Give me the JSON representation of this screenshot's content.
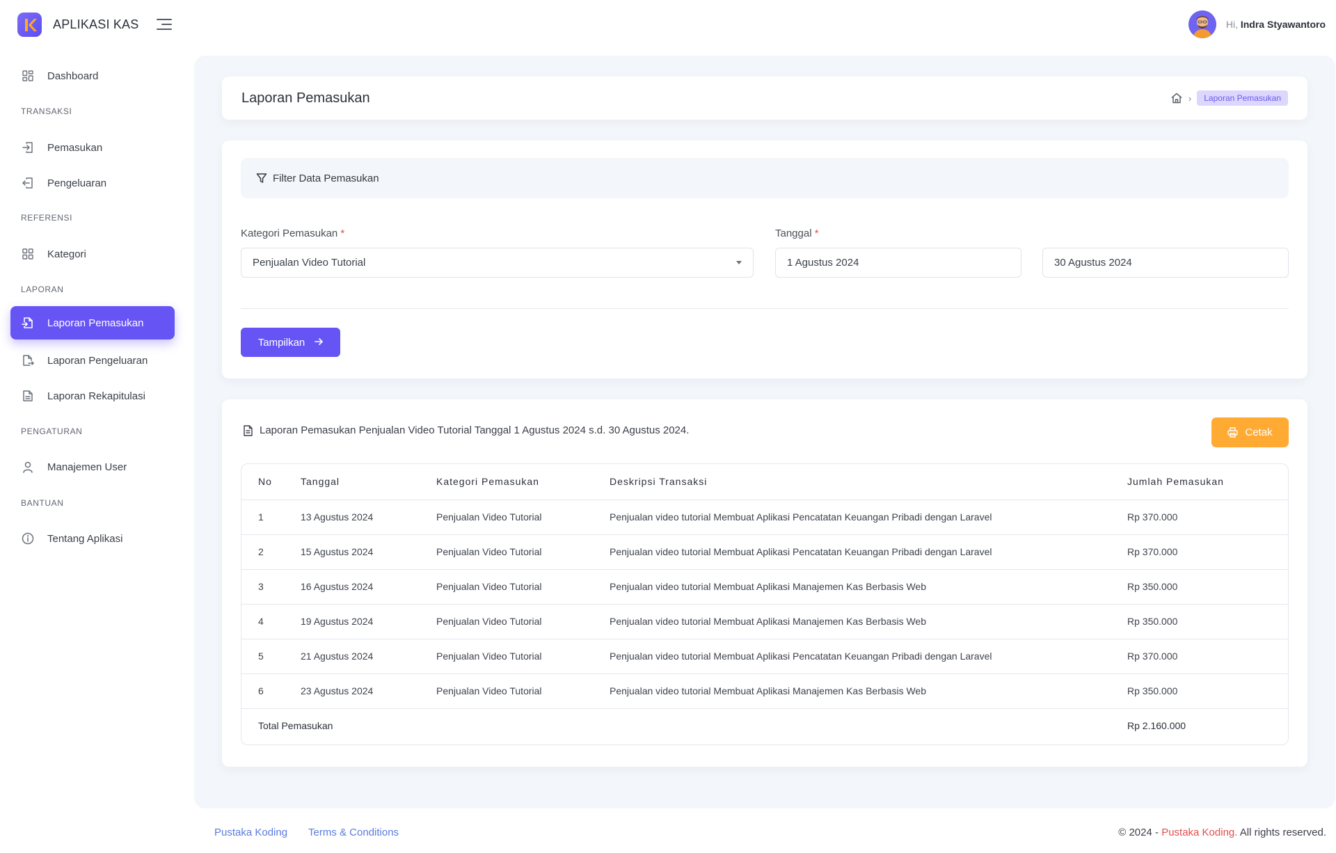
{
  "app": {
    "name": "APLIKASI KAS",
    "accent_color": "#6754f5"
  },
  "user": {
    "greeting": "Hi,",
    "name": "Indra Styawantoro"
  },
  "sidebar": {
    "items": [
      {
        "label": "Dashboard",
        "icon": "grid-icon"
      },
      {
        "label": "TRANSAKSI"
      },
      {
        "label": "Pemasukan",
        "icon": "login-icon"
      },
      {
        "label": "Pengeluaran",
        "icon": "logout-icon"
      },
      {
        "label": "REFERENSI"
      },
      {
        "label": "Kategori",
        "icon": "grid-icon"
      },
      {
        "label": "LAPORAN"
      },
      {
        "label": "Laporan Pemasukan",
        "icon": "file-import-icon",
        "active": true
      },
      {
        "label": "Laporan Pengeluaran",
        "icon": "file-export-icon"
      },
      {
        "label": "Laporan Rekapitulasi",
        "icon": "file-text-icon"
      },
      {
        "label": "PENGATURAN"
      },
      {
        "label": "Manajemen User",
        "icon": "user-icon"
      },
      {
        "label": "BANTUAN"
      },
      {
        "label": "Tentang Aplikasi",
        "icon": "info-icon"
      }
    ]
  },
  "page": {
    "title": "Laporan Pemasukan",
    "breadcrumb_current": "Laporan Pemasukan"
  },
  "filter": {
    "heading": "Filter Data Pemasukan",
    "kategori_label": "Kategori Pemasukan",
    "kategori_value": "Penjualan Video Tutorial",
    "tanggal_label": "Tanggal",
    "required_mark": "*",
    "tanggal_awal": "1 Agustus 2024",
    "tanggal_akhir": "30 Agustus 2024",
    "submit_label": "Tampilkan"
  },
  "result": {
    "caption": "Laporan Pemasukan Penjualan Video Tutorial Tanggal 1 Agustus 2024 s.d. 30 Agustus 2024.",
    "print_label": "Cetak",
    "print_color": "#ffab33",
    "columns": [
      "No",
      "Tanggal",
      "Kategori Pemasukan",
      "Deskripsi Transaksi",
      "Jumlah Pemasukan"
    ],
    "rows": [
      [
        "1",
        "13 Agustus 2024",
        "Penjualan Video Tutorial",
        "Penjualan video tutorial Membuat Aplikasi Pencatatan Keuangan Pribadi dengan Laravel",
        "Rp 370.000"
      ],
      [
        "2",
        "15 Agustus 2024",
        "Penjualan Video Tutorial",
        "Penjualan video tutorial Membuat Aplikasi Pencatatan Keuangan Pribadi dengan Laravel",
        "Rp 370.000"
      ],
      [
        "3",
        "16 Agustus 2024",
        "Penjualan Video Tutorial",
        "Penjualan video tutorial Membuat Aplikasi Manajemen Kas Berbasis Web",
        "Rp 350.000"
      ],
      [
        "4",
        "19 Agustus 2024",
        "Penjualan Video Tutorial",
        "Penjualan video tutorial Membuat Aplikasi Manajemen Kas Berbasis Web",
        "Rp 350.000"
      ],
      [
        "5",
        "21 Agustus 2024",
        "Penjualan Video Tutorial",
        "Penjualan video tutorial Membuat Aplikasi Pencatatan Keuangan Pribadi dengan Laravel",
        "Rp 370.000"
      ],
      [
        "6",
        "23 Agustus 2024",
        "Penjualan Video Tutorial",
        "Penjualan video tutorial Membuat Aplikasi Manajemen Kas Berbasis Web",
        "Rp 350.000"
      ]
    ],
    "total_label": "Total Pemasukan",
    "total_value": "Rp 2.160.000"
  },
  "footer": {
    "link1": "Pustaka Koding",
    "link2": "Terms & Conditions",
    "copyright_prefix": "© 2024 -",
    "copyright_brand": "Pustaka Koding.",
    "copyright_suffix": "All rights reserved."
  }
}
